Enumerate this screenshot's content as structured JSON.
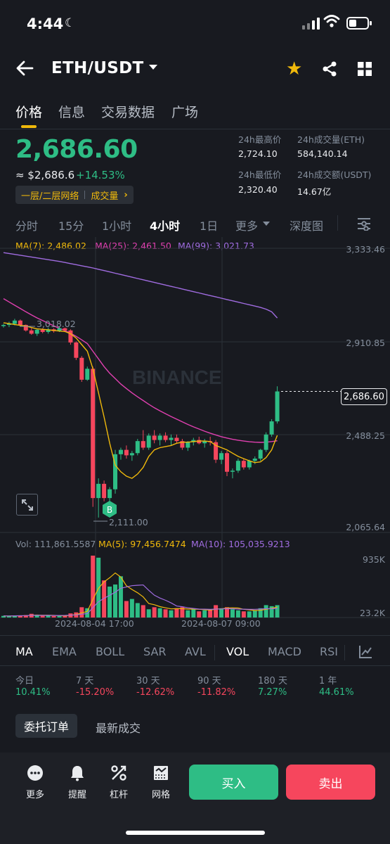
{
  "status_bar": {
    "time": "4:44"
  },
  "header": {
    "pair": "ETH/USDT"
  },
  "main_tabs": [
    {
      "label": "价格"
    },
    {
      "label": "信息"
    },
    {
      "label": "交易数据"
    },
    {
      "label": "广场"
    }
  ],
  "ticker": {
    "price": "2,686.60",
    "usd_value": "≈ $2,686.6",
    "change": "+14.53%",
    "tags": [
      "一层/二层网络",
      "成交量"
    ],
    "stats": {
      "high_label": "24h最高价",
      "high": "2,724.10",
      "vol_eth_label": "24h成交量(ETH)",
      "vol_eth": "584,140.14",
      "low_label": "24h最低价",
      "low": "2,320.40",
      "vol_usdt_label": "24h成交额(USDT)",
      "vol_usdt": "14.67亿"
    }
  },
  "intervals": [
    "分时",
    "15分",
    "1小时",
    "4小时",
    "1日",
    "更多",
    "深度图"
  ],
  "chart": {
    "ma7": "MA(7): 2,486.02",
    "ma25": "MA(25): 2,461.50",
    "ma99": "MA(99): 3,021.73",
    "price_axis": [
      "3,333.46",
      "2,910.85",
      "2,488.25",
      "2,065.64"
    ],
    "current_price": "2,686.60",
    "high_marker": "3,018.02",
    "low_marker": "2,111.00",
    "buy_marker": "B",
    "watermark": "BINANCE",
    "vol_label": "Vol: 111,861.5587",
    "vol_ma5": "MA(5): 97,456.7474",
    "vol_ma10": "MA(10): 105,035.9213",
    "vol_axis": [
      "935K",
      "23.2K"
    ],
    "dates": [
      "2024-08-04 17:00",
      "2024-08-07 09:00"
    ],
    "colors": {
      "up": "#2ebd85",
      "down": "#f6465d",
      "ma7": "#f0b90b",
      "ma25": "#e040b0",
      "ma99": "#a06ce0"
    },
    "candles": [
      [
        2985,
        2995,
        2978,
        2990
      ],
      [
        2990,
        3005,
        2980,
        2995
      ],
      [
        2995,
        3018,
        2988,
        3010
      ],
      [
        3010,
        3015,
        2985,
        2990
      ],
      [
        2990,
        2992,
        2960,
        2965
      ],
      [
        2965,
        2975,
        2945,
        2950
      ],
      [
        2950,
        2972,
        2940,
        2968
      ],
      [
        2968,
        2975,
        2952,
        2958
      ],
      [
        2958,
        2978,
        2950,
        2970
      ],
      [
        2970,
        2975,
        2955,
        2962
      ],
      [
        2962,
        2982,
        2958,
        2975
      ],
      [
        2975,
        2978,
        2960,
        2965
      ],
      [
        2965,
        2970,
        2900,
        2910
      ],
      [
        2910,
        2915,
        2830,
        2840
      ],
      [
        2840,
        2848,
        2730,
        2740
      ],
      [
        2740,
        2800,
        2735,
        2790
      ],
      [
        2790,
        2800,
        2160,
        2200
      ],
      [
        2200,
        2290,
        2111,
        2265
      ],
      [
        2265,
        2280,
        2185,
        2200
      ],
      [
        2200,
        2250,
        2170,
        2240
      ],
      [
        2240,
        2420,
        2220,
        2400
      ],
      [
        2400,
        2430,
        2375,
        2420
      ],
      [
        2420,
        2440,
        2380,
        2395
      ],
      [
        2395,
        2415,
        2370,
        2405
      ],
      [
        2405,
        2470,
        2395,
        2460
      ],
      [
        2460,
        2510,
        2420,
        2430
      ],
      [
        2430,
        2495,
        2420,
        2485
      ],
      [
        2485,
        2510,
        2450,
        2465
      ],
      [
        2465,
        2495,
        2440,
        2485
      ],
      [
        2485,
        2500,
        2455,
        2465
      ],
      [
        2465,
        2490,
        2440,
        2475
      ],
      [
        2475,
        2490,
        2450,
        2460
      ],
      [
        2460,
        2470,
        2420,
        2430
      ],
      [
        2430,
        2460,
        2415,
        2455
      ],
      [
        2455,
        2475,
        2440,
        2465
      ],
      [
        2465,
        2480,
        2445,
        2450
      ],
      [
        2450,
        2470,
        2430,
        2460
      ],
      [
        2460,
        2480,
        2440,
        2455
      ],
      [
        2455,
        2465,
        2360,
        2375
      ],
      [
        2375,
        2415,
        2355,
        2405
      ],
      [
        2405,
        2415,
        2300,
        2320
      ],
      [
        2320,
        2335,
        2290,
        2325
      ],
      [
        2325,
        2380,
        2315,
        2370
      ],
      [
        2370,
        2378,
        2330,
        2340
      ],
      [
        2340,
        2375,
        2330,
        2370
      ],
      [
        2370,
        2390,
        2355,
        2380
      ],
      [
        2380,
        2425,
        2370,
        2420
      ],
      [
        2420,
        2500,
        2410,
        2490
      ],
      [
        2490,
        2560,
        2480,
        2550
      ],
      [
        2550,
        2710,
        2540,
        2686.6
      ]
    ],
    "volumes": [
      8,
      7,
      10,
      9,
      12,
      18,
      10,
      8,
      9,
      7,
      10,
      8,
      20,
      25,
      50,
      45,
      300,
      290,
      180,
      150,
      160,
      200,
      80,
      90,
      70,
      60,
      40,
      50,
      45,
      40,
      35,
      45,
      50,
      35,
      40,
      30,
      35,
      40,
      60,
      45,
      50,
      40,
      35,
      30,
      30,
      35,
      45,
      60,
      55,
      60
    ],
    "ma7_line": [
      3000,
      2996,
      2992,
      2988,
      2985,
      2978,
      2972,
      2970,
      2968,
      2965,
      2962,
      2960,
      2950,
      2930,
      2900,
      2870,
      2790,
      2680,
      2570,
      2450,
      2350,
      2320,
      2300,
      2290,
      2310,
      2340,
      2390,
      2420,
      2430,
      2435,
      2440,
      2450,
      2455,
      2455,
      2458,
      2460,
      2460,
      2458,
      2440,
      2430,
      2420,
      2405,
      2390,
      2380,
      2370,
      2362,
      2365,
      2385,
      2420,
      2486
    ],
    "ma25_line": [
      3110,
      3095,
      3080,
      3065,
      3050,
      3036,
      3022,
      3010,
      2998,
      2986,
      2975,
      2964,
      2952,
      2938,
      2922,
      2905,
      2870,
      2835,
      2800,
      2770,
      2745,
      2720,
      2700,
      2680,
      2662,
      2645,
      2628,
      2612,
      2598,
      2585,
      2572,
      2560,
      2548,
      2536,
      2525,
      2515,
      2505,
      2496,
      2488,
      2480,
      2474,
      2468,
      2464,
      2460,
      2457,
      2455,
      2454,
      2455,
      2458,
      2461.5
    ],
    "ma99_line": [
      3320,
      3316,
      3312,
      3308,
      3304,
      3300,
      3296,
      3292,
      3288,
      3284,
      3280,
      3275,
      3270,
      3265,
      3260,
      3255,
      3250,
      3244,
      3238,
      3232,
      3226,
      3220,
      3214,
      3208,
      3202,
      3196,
      3190,
      3184,
      3178,
      3172,
      3166,
      3160,
      3154,
      3148,
      3142,
      3136,
      3130,
      3124,
      3118,
      3112,
      3106,
      3100,
      3094,
      3088,
      3082,
      3076,
      3070,
      3062,
      3050,
      3021.73
    ]
  },
  "indicators": [
    "MA",
    "EMA",
    "BOLL",
    "SAR",
    "AVL",
    "VOL",
    "MACD",
    "RSI"
  ],
  "performance": [
    {
      "label": "今日",
      "value": "10.41%",
      "dir": "up"
    },
    {
      "label": "7 天",
      "value": "-15.20%",
      "dir": "down"
    },
    {
      "label": "30 天",
      "value": "-12.62%",
      "dir": "down"
    },
    {
      "label": "90 天",
      "value": "-11.82%",
      "dir": "down"
    },
    {
      "label": "180 天",
      "value": "7.27%",
      "dir": "up"
    },
    {
      "label": "1 年",
      "value": "44.61%",
      "dir": "up"
    }
  ],
  "order_tabs": [
    "委托订单",
    "最新成交"
  ],
  "bottom": {
    "actions": [
      "更多",
      "提醒",
      "杠杆",
      "网格"
    ],
    "buy": "买入",
    "sell": "卖出"
  }
}
